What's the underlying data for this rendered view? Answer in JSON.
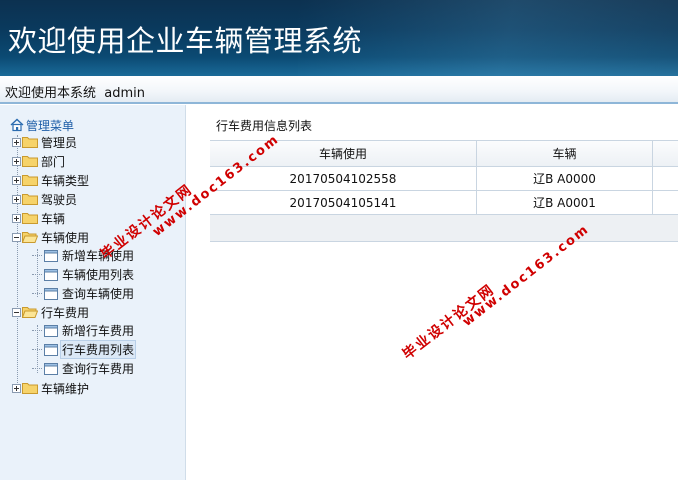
{
  "header": {
    "title": "欢迎使用企业车辆管理系统"
  },
  "welcome": {
    "text": "欢迎使用本系统  admin"
  },
  "sidebar": {
    "root_label": "管理菜单",
    "items": [
      {
        "label": "管理员",
        "expanded": false
      },
      {
        "label": "部门",
        "expanded": false
      },
      {
        "label": "车辆类型",
        "expanded": false
      },
      {
        "label": "驾驶员",
        "expanded": false
      },
      {
        "label": "车辆",
        "expanded": false
      },
      {
        "label": "车辆使用",
        "expanded": true,
        "children": [
          {
            "label": "新增车辆使用"
          },
          {
            "label": "车辆使用列表"
          },
          {
            "label": "查询车辆使用"
          }
        ]
      },
      {
        "label": "行车费用",
        "expanded": true,
        "children": [
          {
            "label": "新增行车费用"
          },
          {
            "label": "行车费用列表",
            "selected": true
          },
          {
            "label": "查询行车费用"
          }
        ]
      },
      {
        "label": "车辆维护",
        "expanded": false
      }
    ]
  },
  "main": {
    "title": "行车费用信息列表",
    "columns": [
      "车辆使用",
      "车辆",
      ""
    ],
    "rows": [
      [
        "20170504102558",
        "辽B A0000",
        ""
      ],
      [
        "20170504105141",
        "辽B A0001",
        ""
      ]
    ]
  },
  "watermark": {
    "line1": "毕业设计论文网",
    "line2": "www.doc163.com"
  },
  "colors": {
    "banner": "#0a3a5e",
    "sidebar_bg": "#eaf2fa",
    "link_blue": "#1f5fa8",
    "watermark_red": "#d00000"
  }
}
